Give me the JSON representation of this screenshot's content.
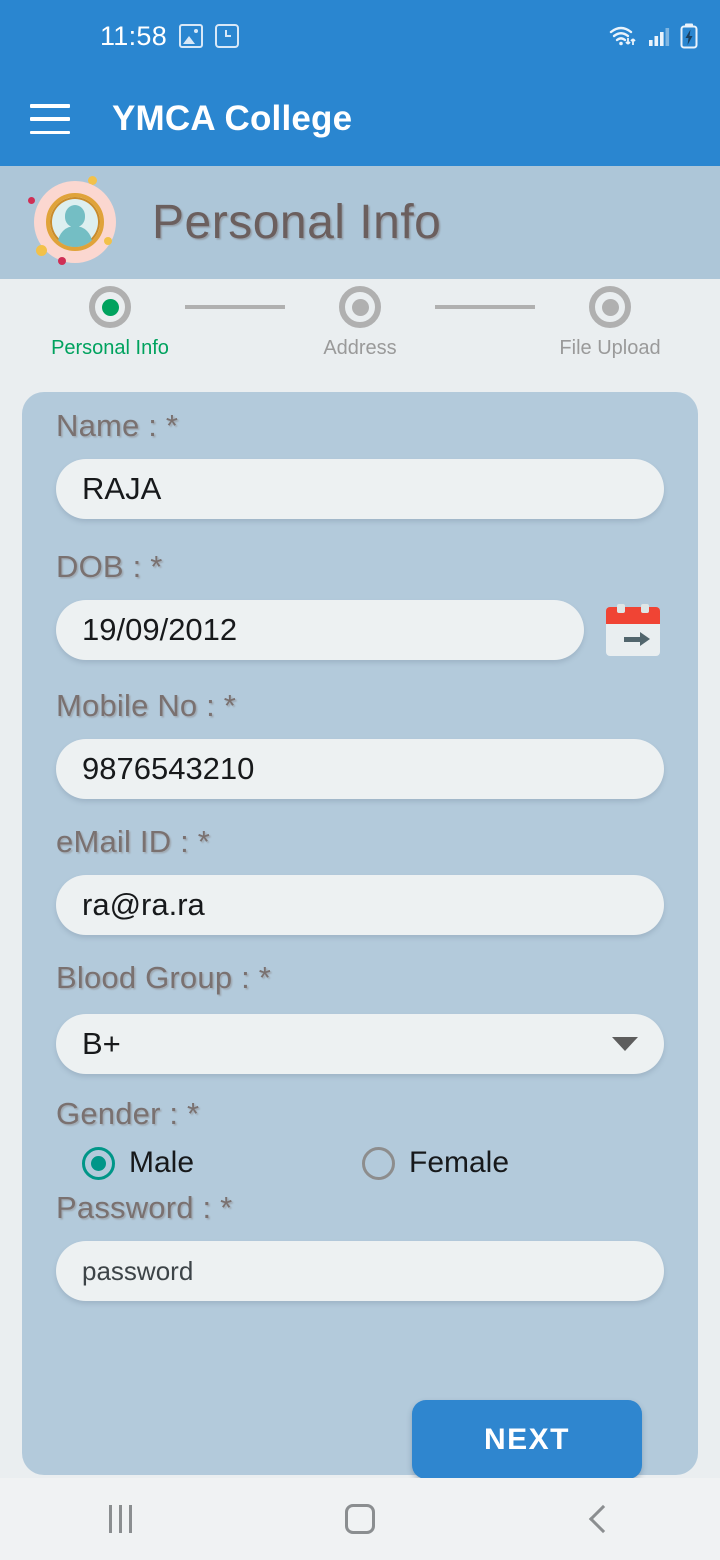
{
  "status_bar": {
    "time": "11:58",
    "left_icons": [
      "gallery-icon",
      "clock-icon"
    ],
    "right_icons": [
      "wifi-icon",
      "signal-icon",
      "battery-charging-icon"
    ]
  },
  "app_bar": {
    "menu_icon": "hamburger-menu-icon",
    "title": "YMCA College"
  },
  "page_header": {
    "title": "Personal Info",
    "avatar_icon": "user-avatar-icon"
  },
  "stepper": {
    "steps": [
      {
        "label": "Personal Info",
        "active": true
      },
      {
        "label": "Address",
        "active": false
      },
      {
        "label": "File Upload",
        "active": false
      }
    ],
    "active_color": "#00a25e",
    "inactive_color": "#b0b0b0"
  },
  "form": {
    "name": {
      "label": "Name : *",
      "value": "RAJA"
    },
    "dob": {
      "label": "DOB : *",
      "value": "19/09/2012",
      "picker_icon": "calendar-icon"
    },
    "mobile": {
      "label": "Mobile No : *",
      "value": "9876543210"
    },
    "email": {
      "label": "eMail ID : *",
      "value": "ra@ra.ra"
    },
    "blood_group": {
      "label": "Blood Group : *",
      "value": "B+",
      "caret_icon": "chevron-down-icon"
    },
    "gender": {
      "label": "Gender : *",
      "options": [
        {
          "label": "Male",
          "selected": true
        },
        {
          "label": "Female",
          "selected": false
        }
      ],
      "selected_color": "#009688"
    },
    "password": {
      "label": "Password : *",
      "value": "password"
    },
    "next_label": "NEXT"
  },
  "nav_bar": {
    "recents_icon": "recents-icon",
    "home_icon": "home-icon",
    "back_icon": "back-icon"
  },
  "colors": {
    "primary": "#2a86d0",
    "header_band": "#adc6d8",
    "card": "#b3cadb",
    "page_bg": "#eaeef0",
    "label_text": "#7a7170"
  }
}
